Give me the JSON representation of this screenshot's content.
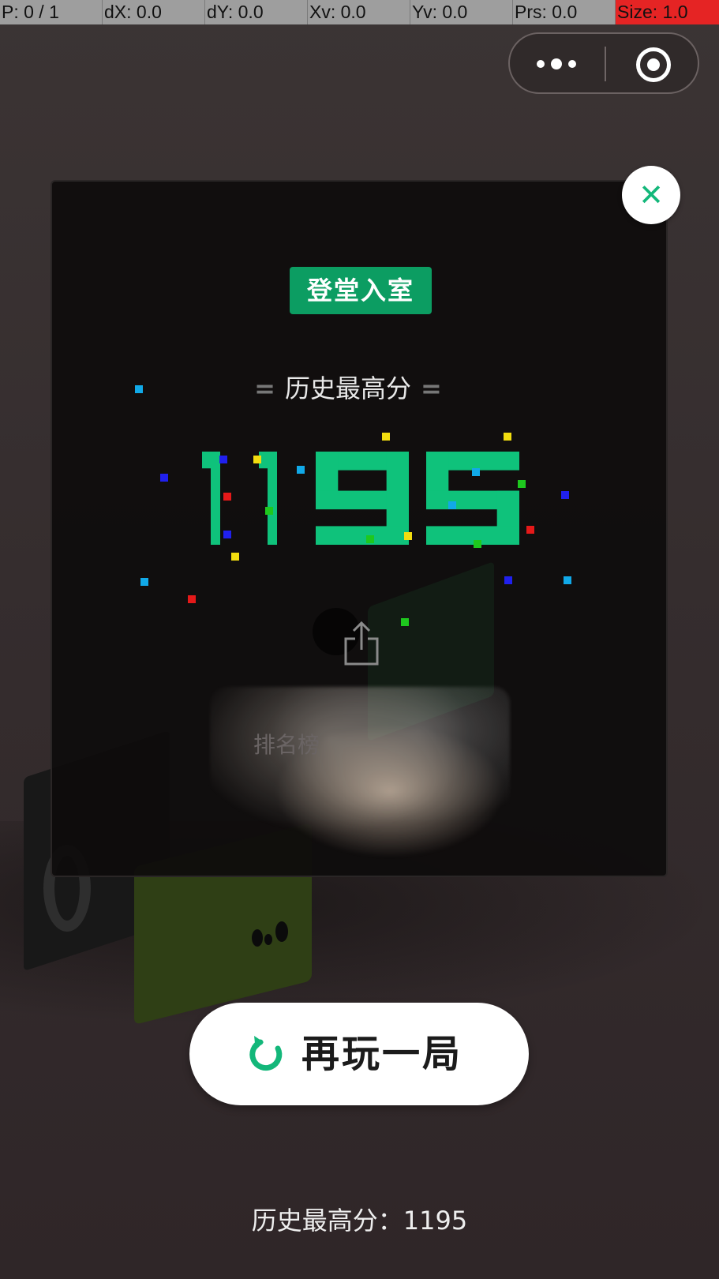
{
  "status_bar": {
    "cells": [
      "P: 0 / 1",
      "dX: 0.0",
      "dY: 0.0",
      "Xv: 0.0",
      "Yv: 0.0",
      "Prs: 0.0",
      "Size: 1.0"
    ],
    "alert_color": "#e52424"
  },
  "capsule": {
    "more_icon": "more-dots-icon",
    "close_icon": "target-close-icon"
  },
  "modal": {
    "close_icon": "close-x-icon",
    "rank_title": "登堂入室",
    "best_label": "历史最高分",
    "best_score_digits": "1195",
    "score_color": "#0fc27b",
    "share_icon": "share-icon",
    "rank_list_label": "排名榜"
  },
  "replay": {
    "label": "再玩一局",
    "icon": "refresh-icon",
    "icon_color": "#13b77a"
  },
  "footer": {
    "best_text": "历史最高分：1195"
  }
}
